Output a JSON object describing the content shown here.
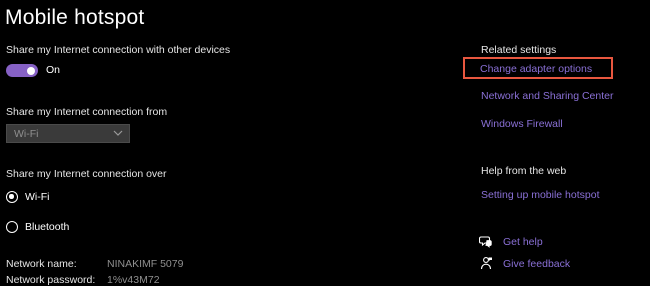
{
  "page": {
    "title": "Mobile hotspot"
  },
  "share_connection": {
    "label": "Share my Internet connection with other devices",
    "toggle_state": "On",
    "toggle_on": true
  },
  "share_from": {
    "label": "Share my Internet connection from",
    "selected": "Wi-Fi"
  },
  "share_over": {
    "label": "Share my Internet connection over",
    "options": [
      {
        "label": "Wi-Fi",
        "selected": true
      },
      {
        "label": "Bluetooth",
        "selected": false
      }
    ]
  },
  "network_info": {
    "name_label": "Network name:",
    "name_value": "NINAKIMF 5079",
    "password_label": "Network password:",
    "password_value": "1%v43M72"
  },
  "related_settings": {
    "heading": "Related settings",
    "links": [
      {
        "label": "Change adapter options"
      },
      {
        "label": "Network and Sharing Center"
      },
      {
        "label": "Windows Firewall"
      }
    ]
  },
  "help": {
    "heading": "Help from the web",
    "link": "Setting up mobile hotspot",
    "get_help": "Get help",
    "give_feedback": "Give feedback"
  },
  "colors": {
    "accent": "#8661c5",
    "link": "#8a70d6",
    "highlight": "#e8573f",
    "background": "#000000"
  },
  "icons": {
    "dropdown": "chevron-down-icon",
    "get_help": "get-help-icon",
    "feedback": "give-feedback-icon"
  }
}
